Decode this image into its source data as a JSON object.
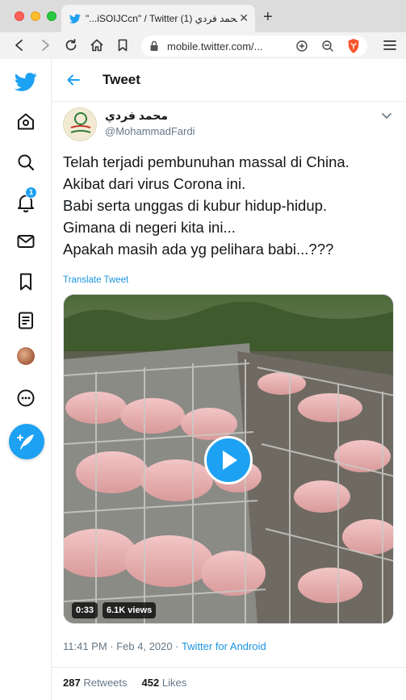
{
  "browser": {
    "tab_title": "\"...iSOIJCcn\" / Twitter (1) محمد فردي",
    "url": "mobile.twitter.com/..."
  },
  "colors": {
    "twitter_blue": "#1da1f2",
    "link_blue": "#1b95e0",
    "text_primary": "#14171a",
    "text_secondary": "#657786"
  },
  "sidebar": {
    "items": [
      {
        "icon": "twitter-logo-icon"
      },
      {
        "icon": "home-icon"
      },
      {
        "icon": "search-icon"
      },
      {
        "icon": "notifications-icon",
        "badge": "1"
      },
      {
        "icon": "messages-icon"
      },
      {
        "icon": "bookmarks-icon"
      },
      {
        "icon": "lists-icon"
      },
      {
        "icon": "profile-avatar"
      },
      {
        "icon": "more-icon"
      },
      {
        "icon": "compose-tweet-icon"
      }
    ]
  },
  "header": {
    "title": "Tweet"
  },
  "tweet": {
    "display_name": "محمد فردي",
    "handle": "@MohammadFardi",
    "text_lines": [
      "Telah terjadi pembunuhan massal di China.",
      "Akibat dari virus Corona ini.",
      "Babi serta unggas di kubur hidup-hidup.",
      "Gimana di negeri kita ini...",
      "Apakah masih ada yg pelihara babi...???"
    ],
    "translate_label": "Translate Tweet",
    "video": {
      "duration": "0:33",
      "views": "6.1K views"
    },
    "time": "11:41 PM · Feb 4, 2020 · ",
    "source": "Twitter for Android",
    "retweets_count": "287",
    "retweets_label": "Retweets",
    "likes_count": "452",
    "likes_label": "Likes"
  }
}
